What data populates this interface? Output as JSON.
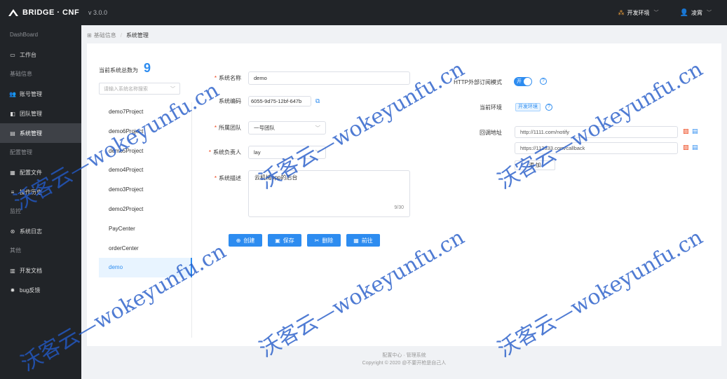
{
  "app": {
    "brand": "BRIDGE · CNF",
    "version": "v 3.0.0"
  },
  "topbar": {
    "env_label": "开发环境",
    "user_name": "凌霄"
  },
  "sidebar": {
    "groups": [
      {
        "title": "DashBoard",
        "items": [
          {
            "label": "工作台",
            "icon": "monitor-icon"
          }
        ]
      },
      {
        "title": "基础信息",
        "items": [
          {
            "label": "账号管理",
            "icon": "users-icon"
          },
          {
            "label": "团队管理",
            "icon": "team-icon"
          },
          {
            "label": "系统管理",
            "icon": "document-icon",
            "active": true
          }
        ]
      },
      {
        "title": "配置管理",
        "items": [
          {
            "label": "配置文件",
            "icon": "file-icon"
          },
          {
            "label": "操作历史",
            "icon": "list-icon"
          }
        ]
      },
      {
        "title": "监控",
        "items": [
          {
            "label": "系统日志",
            "icon": "log-icon"
          }
        ]
      },
      {
        "title": "其他",
        "items": [
          {
            "label": "开发文档",
            "icon": "book-icon"
          },
          {
            "label": "bug反馈",
            "icon": "bug-icon"
          }
        ]
      }
    ]
  },
  "breadcrumb": {
    "parent": "基础信息",
    "current": "系统管理"
  },
  "systems": {
    "count_label": "当前系统总数为",
    "count": "9",
    "search_placeholder": "请输入系统名称搜索",
    "items": [
      "demo7Project",
      "demo6Project",
      "demo5Project",
      "demo4Project",
      "demo3Project",
      "demo2Project",
      "PayCenter",
      "orderCenter",
      "demo"
    ],
    "active_index": 8
  },
  "form": {
    "name_label": "系统名称",
    "name_value": "demo",
    "code_label": "系统编码",
    "code_value": "6055-9d75-12bf-647b",
    "team_label": "所属团队",
    "team_value": "一号团队",
    "owner_label": "系统负责人",
    "owner_value": "lay",
    "desc_label": "系统描述",
    "desc_value": "云机械app的后台",
    "desc_counter": "9/30"
  },
  "buttons": {
    "create": "创建",
    "save": "保存",
    "delete": "删除",
    "goto": "前往"
  },
  "right": {
    "http_label": "HTTP外部订阅模式",
    "toggle_label": "开",
    "env_label": "当前环境",
    "env_tag": "开发环境",
    "callback_label": "回调地址",
    "callbacks": [
      "http://1111.com/notify",
      "https://112333.com/callback"
    ],
    "add_label": "添 加"
  },
  "footer": {
    "line1": "配置中心 · 管理系统",
    "line2": "Copyright © 2020 @不要开枪是自己人"
  },
  "watermark": {
    "text": "沃客云—wokeyunfu.cn",
    "color": "#235ac8"
  }
}
